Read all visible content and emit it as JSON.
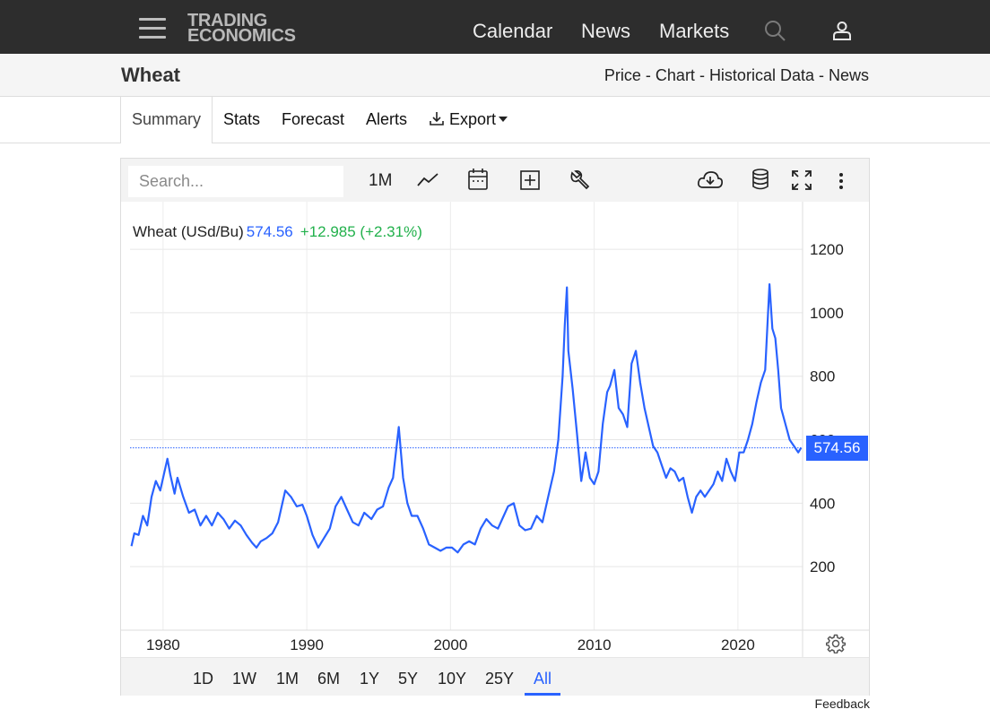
{
  "brand": {
    "line1": "TRADING",
    "line2": "ECONOMICS"
  },
  "nav": {
    "calendar": "Calendar",
    "news": "News",
    "markets": "Markets"
  },
  "icons": {
    "menu": "hamburger-menu-icon",
    "search": "search-icon",
    "user": "user-icon"
  },
  "page": {
    "title": "Wheat",
    "links": [
      "Price",
      "Chart",
      "Historical Data",
      "News"
    ],
    "link_separator": "-"
  },
  "tabs": {
    "summary": "Summary",
    "stats": "Stats",
    "forecast": "Forecast",
    "alerts": "Alerts",
    "export": "Export",
    "active": "Summary"
  },
  "toolbar": {
    "search_placeholder": "Search...",
    "interval": "1M"
  },
  "legend": {
    "name": "Wheat (USd/Bu)",
    "price": "574.56",
    "change": "+12.985 (+2.31%)"
  },
  "price_tag": "574.56",
  "ranges": {
    "items": [
      "1D",
      "1W",
      "1M",
      "6M",
      "1Y",
      "5Y",
      "10Y",
      "25Y",
      "All"
    ],
    "active": "All"
  },
  "feedback": "Feedback",
  "colors": {
    "series": "#2962ff",
    "positive": "#22b14c",
    "topbar": "#2d2d2d"
  },
  "chart_data": {
    "type": "line",
    "title": "",
    "xlabel": "",
    "ylabel": "",
    "y_ticks": [
      200,
      400,
      600,
      800,
      1000,
      1200
    ],
    "x_ticks": [
      1980,
      1990,
      2000,
      2010,
      2020
    ],
    "xlim": [
      1977.7,
      2024.5
    ],
    "ylim": [
      0,
      1350
    ],
    "grid": true,
    "last_value": 574.56,
    "series": [
      {
        "name": "Wheat (USd/Bu)",
        "x": [
          1977.8,
          1978.0,
          1978.3,
          1978.6,
          1978.9,
          1979.2,
          1979.5,
          1979.8,
          1980.0,
          1980.3,
          1980.5,
          1980.8,
          1981.0,
          1981.4,
          1981.8,
          1982.2,
          1982.6,
          1983.0,
          1983.4,
          1983.8,
          1984.2,
          1984.6,
          1985.0,
          1985.4,
          1985.8,
          1986.2,
          1986.5,
          1986.8,
          1987.2,
          1987.6,
          1988.0,
          1988.5,
          1988.9,
          1989.3,
          1989.7,
          1990.0,
          1990.4,
          1990.8,
          1991.2,
          1991.6,
          1992.0,
          1992.4,
          1992.8,
          1993.2,
          1993.6,
          1994.0,
          1994.5,
          1994.9,
          1995.3,
          1995.7,
          1996.0,
          1996.2,
          1996.4,
          1996.7,
          1997.0,
          1997.3,
          1997.7,
          1998.1,
          1998.5,
          1998.9,
          1999.3,
          1999.7,
          2000.1,
          2000.5,
          2000.9,
          2001.3,
          2001.7,
          2002.1,
          2002.5,
          2002.9,
          2003.3,
          2003.7,
          2004.0,
          2004.4,
          2004.8,
          2005.2,
          2005.6,
          2006.0,
          2006.4,
          2006.8,
          2007.2,
          2007.5,
          2007.8,
          2007.95,
          2008.1,
          2008.2,
          2008.5,
          2008.8,
          2009.1,
          2009.4,
          2009.7,
          2010.0,
          2010.3,
          2010.6,
          2010.9,
          2011.1,
          2011.4,
          2011.7,
          2012.0,
          2012.3,
          2012.6,
          2012.9,
          2013.2,
          2013.5,
          2013.8,
          2014.1,
          2014.4,
          2014.7,
          2015.0,
          2015.3,
          2015.6,
          2015.9,
          2016.2,
          2016.5,
          2016.8,
          2017.1,
          2017.4,
          2017.7,
          2018.0,
          2018.3,
          2018.6,
          2018.9,
          2019.2,
          2019.5,
          2019.8,
          2020.1,
          2020.4,
          2020.7,
          2021.0,
          2021.3,
          2021.6,
          2021.9,
          2022.1,
          2022.2,
          2022.4,
          2022.6,
          2022.8,
          2023.0,
          2023.3,
          2023.6,
          2023.9,
          2024.2,
          2024.4
        ],
        "values": [
          265,
          305,
          300,
          360,
          330,
          420,
          470,
          440,
          480,
          540,
          490,
          430,
          480,
          420,
          370,
          380,
          330,
          360,
          330,
          370,
          350,
          320,
          345,
          330,
          300,
          275,
          260,
          280,
          290,
          305,
          340,
          440,
          420,
          390,
          395,
          360,
          300,
          260,
          290,
          320,
          390,
          420,
          380,
          340,
          330,
          370,
          350,
          380,
          390,
          450,
          480,
          560,
          640,
          480,
          400,
          360,
          360,
          320,
          270,
          260,
          250,
          260,
          260,
          245,
          270,
          280,
          270,
          320,
          350,
          330,
          320,
          360,
          390,
          400,
          330,
          315,
          320,
          360,
          340,
          420,
          500,
          600,
          800,
          960,
          1080,
          880,
          760,
          620,
          470,
          560,
          480,
          460,
          500,
          650,
          750,
          770,
          820,
          700,
          680,
          640,
          840,
          880,
          780,
          700,
          640,
          580,
          560,
          520,
          480,
          510,
          500,
          470,
          480,
          420,
          370,
          420,
          440,
          420,
          440,
          460,
          500,
          470,
          540,
          500,
          470,
          560,
          560,
          600,
          650,
          720,
          780,
          820,
          1000,
          1090,
          950,
          920,
          820,
          700,
          650,
          600,
          580,
          560,
          575
        ]
      }
    ]
  }
}
